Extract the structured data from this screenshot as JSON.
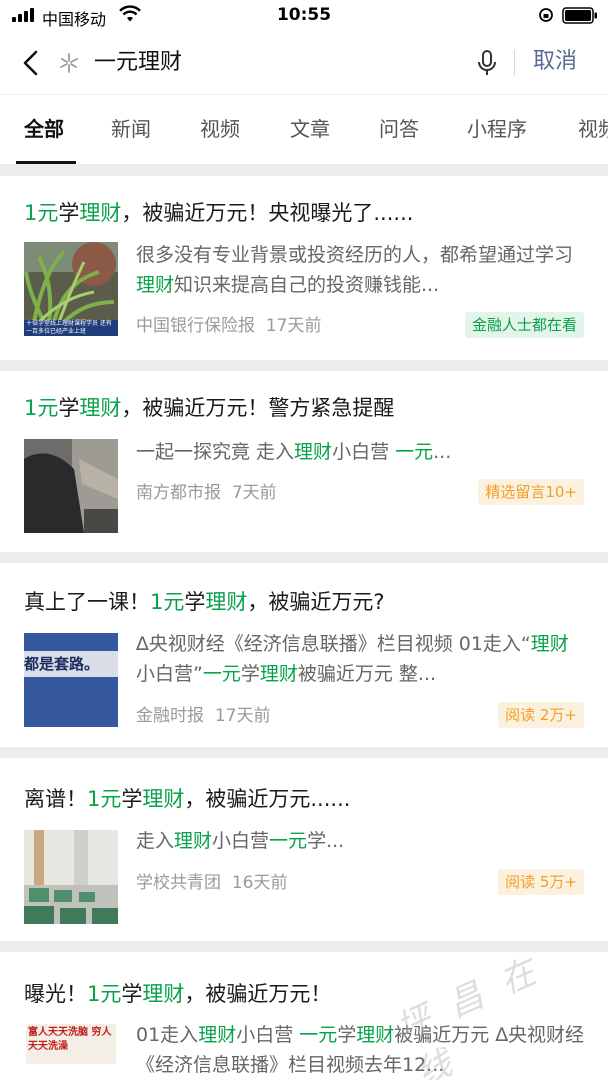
{
  "status_bar": {
    "carrier": "中国移动",
    "time": "10:55"
  },
  "search": {
    "query": "一元理财",
    "cancel_label": "取消"
  },
  "tabs": [
    {
      "label": "全部",
      "active": true
    },
    {
      "label": "新闻"
    },
    {
      "label": "视频"
    },
    {
      "label": "文章"
    },
    {
      "label": "问答"
    },
    {
      "label": "小程序"
    },
    {
      "label": "视频"
    }
  ],
  "results": [
    {
      "title": [
        "1元",
        "学",
        "理财",
        "，被骗近万元！央视曝光了......"
      ],
      "snippet": [
        "很多没有专业背景或投资经历的人，都希望通过学习",
        "理财",
        "知识来提高自己的投资赚钱能..."
      ],
      "source": "中国银行保险报",
      "time": "17天前",
      "badge": "金融人士都在看",
      "badge_type": "green",
      "thumb_caption": "十倍学堂线上理财课程学员 还有一百多位已经产业上班"
    },
    {
      "title": [
        "1元",
        "学",
        "理财",
        "，被骗近万元！警方紧急提醒"
      ],
      "snippet": [
        "一起一探究竟 走入",
        "理财",
        "小白营 ",
        "一元",
        "..."
      ],
      "source": "南方都市报",
      "time": "7天前",
      "badge": "精选留言10+",
      "badge_type": "orange"
    },
    {
      "title": [
        "真上了一课！",
        "1元",
        "学",
        "理财",
        "，被骗近万元?"
      ],
      "snippet": [
        "∆央视财经《经济信息联播》栏目视频 01走入“",
        "理财",
        "小白营”",
        "一元",
        "学",
        "理财",
        "被骗近万元 整..."
      ],
      "source": "金融时报",
      "time": "17天前",
      "badge": "阅读 2万+",
      "badge_type": "orange",
      "thumb_caption": "都是套路。"
    },
    {
      "title": [
        "离谱！",
        "1元",
        "学",
        "理财",
        "，被骗近万元......"
      ],
      "snippet": [
        "走入",
        "理财",
        "小白营",
        "一元",
        "学..."
      ],
      "source": "学校共青团",
      "time": "16天前",
      "badge": "阅读 5万+",
      "badge_type": "orange"
    },
    {
      "title": [
        "曝光！",
        "1元",
        "学",
        "理财",
        "，被骗近万元！"
      ],
      "snippet": [
        "01走入",
        "理财",
        "小白营 ",
        "一元",
        "学",
        "理财",
        "被骗近万元 ∆央视财经《经济信息联播》栏目视频去年12..."
      ],
      "thumb_caption": "富人天天洗脑 穷人天天洗澡"
    }
  ],
  "watermark": "坪 昌 在 线"
}
